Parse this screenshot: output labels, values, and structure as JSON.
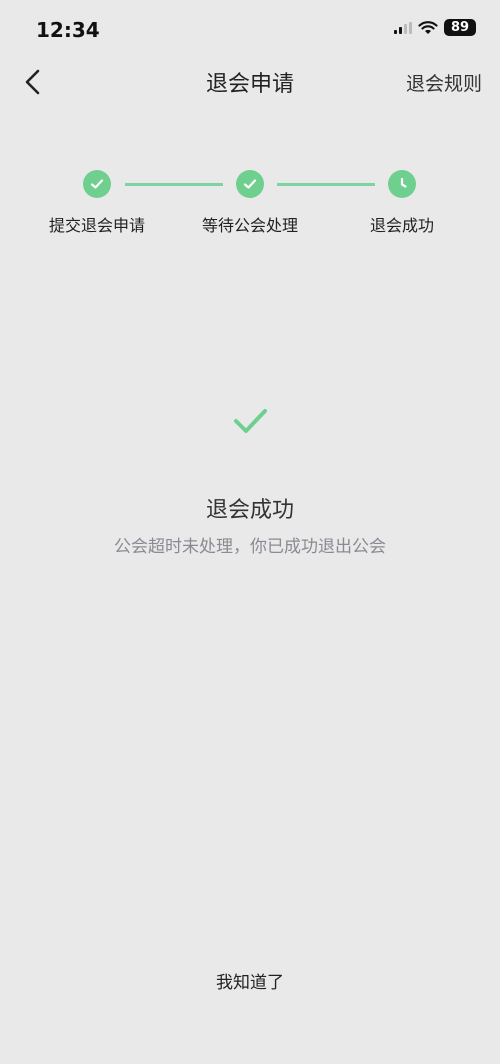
{
  "status_bar": {
    "time": "12:34",
    "battery": "89",
    "signal_icon": "signal-icon",
    "wifi_icon": "wifi-icon"
  },
  "nav": {
    "title": "退会申请",
    "right_link": "退会规则",
    "back_icon": "chevron-left-icon"
  },
  "steps": [
    {
      "label": "提交退会申请",
      "icon": "check-circle-icon"
    },
    {
      "label": "等待公会处理",
      "icon": "check-circle-icon"
    },
    {
      "label": "退会成功",
      "icon": "clock-circle-icon"
    }
  ],
  "result": {
    "icon": "check-icon",
    "title": "退会成功",
    "description": "公会超时未处理，你已成功退出公会"
  },
  "footer": {
    "confirm_label": "我知道了"
  },
  "colors": {
    "background": "#e9e9e9",
    "accent_green": "#6fcf8e",
    "description_gray": "#8a8a92"
  }
}
